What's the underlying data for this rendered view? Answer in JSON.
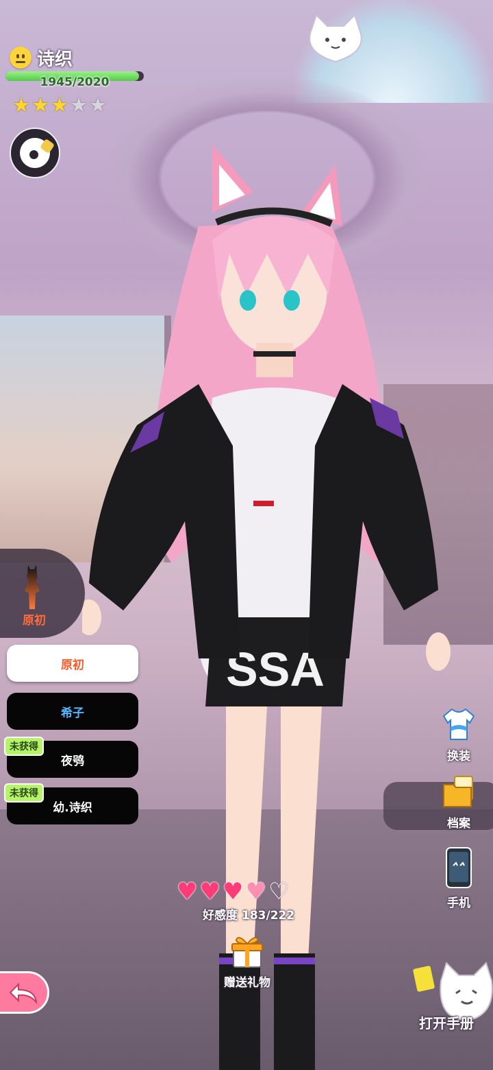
{
  "player": {
    "name": "诗织",
    "exp_text": "1945/2020",
    "exp_fraction": 0.963,
    "stars_filled": 3,
    "stars_total": 5
  },
  "outfit_selector": {
    "current_label": "原初",
    "items": [
      {
        "label": "原初",
        "state": "selected",
        "locked_tag": ""
      },
      {
        "label": "希子",
        "state": "owned",
        "locked_tag": ""
      },
      {
        "label": "夜鸮",
        "state": "locked",
        "locked_tag": "未获得"
      },
      {
        "label": "幼.诗织",
        "state": "locked",
        "locked_tag": "未获得"
      }
    ]
  },
  "side_menu": {
    "dress_label": "换装",
    "profile_label": "档案",
    "phone_label": "手机"
  },
  "affection": {
    "label": "好感度",
    "value_text": "183/222",
    "hearts": [
      "full",
      "full",
      "full",
      "half",
      "empty"
    ]
  },
  "gift": {
    "label": "赠送礼物"
  },
  "handbook": {
    "label": "打开手册"
  },
  "icons": {
    "mood": "neutral-face-icon",
    "emote": "emote-wheel-icon",
    "dress": "shirt-icon",
    "profile": "folder-icon",
    "phone": "phone-icon",
    "gift": "gift-box-icon",
    "back": "back-arrow-icon",
    "handbook": "cat-mascot-icon"
  },
  "colors": {
    "accent_orange": "#ff5a28",
    "accent_blue": "#4fb8ff",
    "locked_green": "#b6f36a",
    "heart_pink": "#ff3b78",
    "back_pink": "#ff7a9e"
  }
}
